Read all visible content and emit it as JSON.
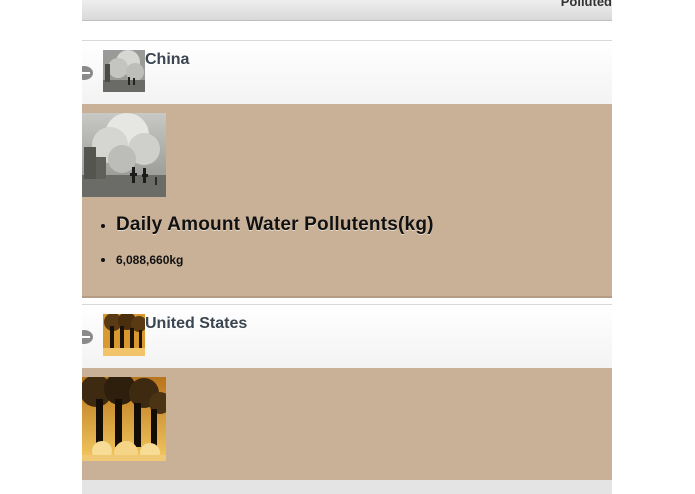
{
  "topbar": {
    "title": "Polluted"
  },
  "countries": [
    {
      "name": "China",
      "stats": [
        {
          "label": "Daily Amount Water Pollutents(kg)"
        },
        {
          "label": "6,088,660kg"
        }
      ]
    },
    {
      "name": "United States"
    }
  ],
  "colors": {
    "content_background": "#c9b198",
    "header_text": "#3a4550"
  },
  "icons": [
    "collapse-icon",
    "collapse-icon"
  ]
}
